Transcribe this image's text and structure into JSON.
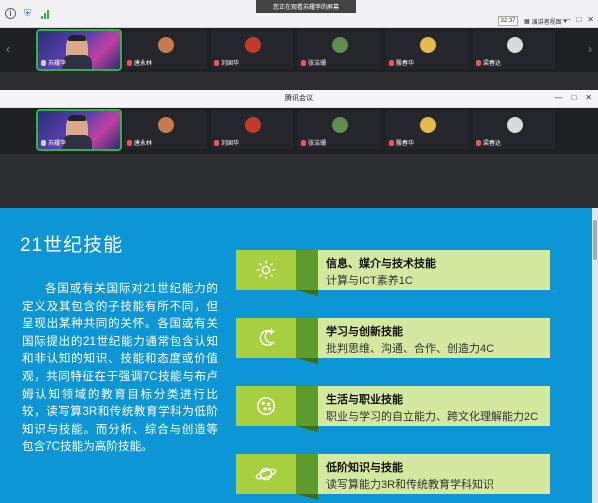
{
  "share_banner": "您正在观看苏耀李的屏幕",
  "top_time": "32:37",
  "presenter_view_label": "演讲者视图",
  "window_title": "腾讯会议",
  "participants_top": [
    {
      "name": "苏耀李",
      "type": "video",
      "active": true
    },
    {
      "name": "唐永林",
      "type": "avatar"
    },
    {
      "name": "刘国华",
      "type": "avatar"
    },
    {
      "name": "张洁珊",
      "type": "avatar"
    },
    {
      "name": "殷春华",
      "type": "avatar"
    },
    {
      "name": "梁春达",
      "type": "avatar"
    }
  ],
  "participants_bottom": [
    {
      "name": "苏耀李",
      "type": "video",
      "active": true
    },
    {
      "name": "唐永林",
      "type": "avatar"
    },
    {
      "name": "刘国华",
      "type": "avatar"
    },
    {
      "name": "张洁珊",
      "type": "avatar"
    },
    {
      "name": "殷春华",
      "type": "avatar"
    },
    {
      "name": "梁春达",
      "type": "avatar"
    }
  ],
  "slide": {
    "title": "21世纪技能",
    "body": "各国或有关国际对21世纪能力的定义及其包含的子技能有所不同，但呈现出某种共同的关怀。各国或有关国际提出的21世纪能力通常包含认知和非认知的知识、技能和态度或价值观，共同特征在于强调7C技能与布卢姆认知领域的教育目标分类进行比较，读写算3R和传统教育学科为低阶知识与技能。而分析、综合与创造等包含7C技能为高阶技能。",
    "cards": [
      {
        "heading": "信息、媒介与技术技能",
        "sub": "计算与ICT素养1C",
        "icon": "sun-icon"
      },
      {
        "heading": "学习与创新技能",
        "sub": "批判思维、沟通、合作、创造力4C",
        "icon": "moon-icon"
      },
      {
        "heading": "生活与职业技能",
        "sub": "职业与学习的自立能力、跨文化理解能力2C",
        "icon": "cookie-icon"
      },
      {
        "heading": "低阶知识与技能",
        "sub": "读写算能力3R和传统教育学科知识",
        "icon": "planet-icon"
      }
    ]
  },
  "colors": {
    "slide_bg": "#0d96d6",
    "card_bg": "#d4e8a0",
    "card_icon_bg": "#a8cf3f",
    "fold": "#5d9c2c",
    "active_outline": "#2fb24a"
  }
}
